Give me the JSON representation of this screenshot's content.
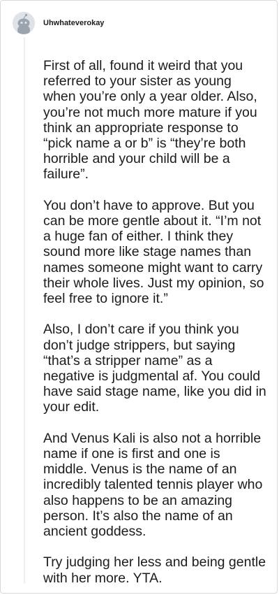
{
  "comment": {
    "author": "Uhwhateverokay",
    "avatar_icon": "snoo-avatar-icon",
    "paragraphs": [
      "First of all, found it weird that you referred to your sister as young when you’re only a year older. Also, you’re not much more mature if you think an appropriate response to “pick name a or b” is “they’re both horrible and your child will be a failure”.",
      "You don’t have to approve. But you can be more gentle about it. “I’m not a huge fan of either. I think they sound more like stage names than names someone might want to carry their whole lives. Just my opinion, so feel free to ignore it.”",
      "Also, I don’t care if you think you don’t judge strippers, but saying “that’s a stripper name” as a negative is judgmental af. You could have said stage name, like you did in your edit.",
      "And Venus Kali is also not a horrible name if one is first and one is middle. Venus is the name of an incredibly talented tennis player who also happens to be an amazing person. It’s also the name of an ancient goddess.",
      "Try judging her less and being gentle with her more. YTA."
    ]
  }
}
